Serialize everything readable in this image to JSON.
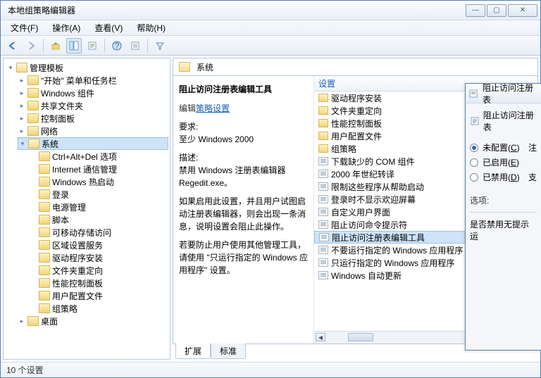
{
  "window": {
    "title": "本地组策略编辑器"
  },
  "menu": {
    "file": "文件(F)",
    "action": "操作(A)",
    "view": "查看(V)",
    "help": "帮助(H)"
  },
  "tree": {
    "root": "管理模板",
    "items": [
      "\"开始\" 菜单和任务栏",
      "Windows 组件",
      "共享文件夹",
      "控制面板",
      "网络"
    ],
    "system": "系统",
    "systemChildren": [
      "Ctrl+Alt+Del 选项",
      "Internet 通信管理",
      "Windows 热启动",
      "登录",
      "电源管理",
      "脚本",
      "可移动存储访问",
      "区域设置服务",
      "驱动程序安装",
      "文件夹重定向",
      "性能控制面板",
      "用户配置文件",
      "组策略"
    ],
    "desktop": "桌面"
  },
  "right": {
    "headerTitle": "系统",
    "detail": {
      "title": "阻止访问注册表编辑工具",
      "editLabel": "编辑",
      "editLink": "策略设置",
      "reqLabel": "要求:",
      "reqText": "至少 Windows 2000",
      "descLabel": "描述:",
      "desc1": "禁用 Windows 注册表编辑器 Regedit.exe。",
      "desc2": "如果启用此设置，并且用户试图启动注册表编辑器，则会出现一条消息，说明设置会阻止此操作。",
      "desc3": "若要防止用户使用其他管理工具，请使用 \"只运行指定的 Windows 应用程序\" 设置。"
    },
    "listHeader": "设置",
    "rows": [
      {
        "t": "folder",
        "l": "驱动程序安装"
      },
      {
        "t": "folder",
        "l": "文件夹重定向"
      },
      {
        "t": "folder",
        "l": "性能控制面板"
      },
      {
        "t": "folder",
        "l": "用户配置文件"
      },
      {
        "t": "folder",
        "l": "组策略"
      },
      {
        "t": "policy",
        "l": "下载缺少的 COM 组件"
      },
      {
        "t": "policy",
        "l": "2000 年世纪转译"
      },
      {
        "t": "policy",
        "l": "限制这些程序从帮助启动"
      },
      {
        "t": "policy",
        "l": "登录时不显示欢迎屏幕"
      },
      {
        "t": "policy",
        "l": "自定义用户界面"
      },
      {
        "t": "policy",
        "l": "阻止访问命令提示符"
      },
      {
        "t": "policy",
        "l": "阻止访问注册表编辑工具",
        "sel": true
      },
      {
        "t": "policy",
        "l": "不要运行指定的 Windows 应用程序"
      },
      {
        "t": "policy",
        "l": "只运行指定的 Windows 应用程序"
      },
      {
        "t": "policy",
        "l": "Windows 自动更新"
      }
    ],
    "tabs": {
      "extended": "扩展",
      "standard": "标准"
    }
  },
  "status": "10 个设置",
  "dialog": {
    "title": "阻止访问注册表",
    "policy": "阻止访问注册表",
    "notConfigured": "未配置(C)",
    "enabled": "已启用(E)",
    "disabled": "已禁用(D)",
    "sideChars": {
      "comment": "注",
      "support": "支"
    },
    "optionsLabel": "选项:",
    "optionText": "是否禁用无提示运"
  }
}
